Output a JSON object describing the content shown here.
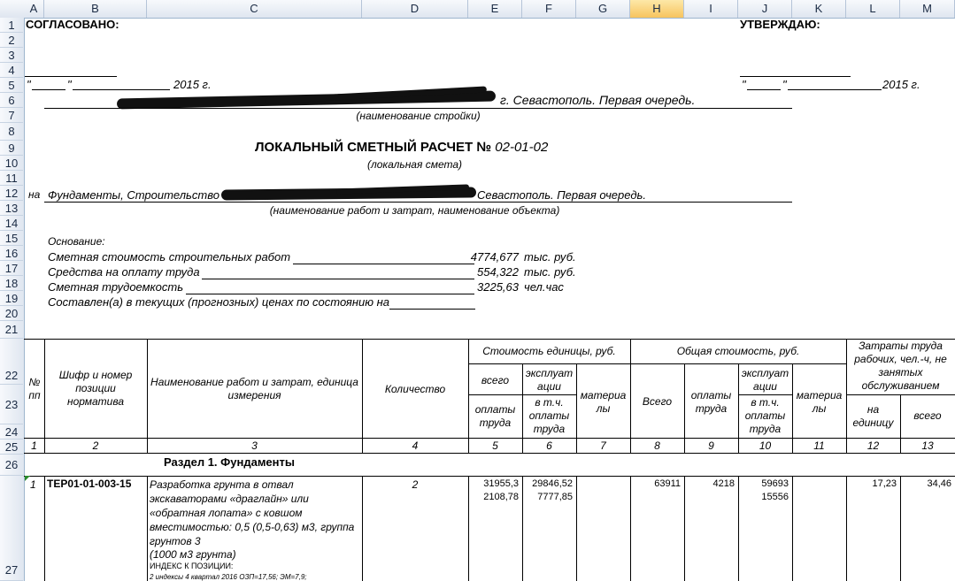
{
  "columns": [
    "A",
    "B",
    "C",
    "D",
    "E",
    "F",
    "G",
    "H",
    "I",
    "J",
    "K",
    "L",
    "M"
  ],
  "rows": [
    "1",
    "2",
    "3",
    "4",
    "5",
    "6",
    "7",
    "8",
    "9",
    "10",
    "11",
    "12",
    "13",
    "14",
    "15",
    "16",
    "17",
    "18",
    "19",
    "20",
    "21",
    "22",
    "23",
    "24",
    "25",
    "26",
    "27"
  ],
  "doc": {
    "agreed": "СОГЛАСОВАНО:",
    "approve": "УТВЕРЖДАЮ:",
    "date_left_q1": "\"",
    "date_left_q2": "\"",
    "date_left_year": "2015 г.",
    "date_right_q1": "\"",
    "date_right_q2": "\"",
    "date_right_year": "2015 г.",
    "construction_name": "г. Севастополь. Первая очередь.",
    "construction_caption": "(наименование стройки)",
    "title_prefix": "ЛОКАЛЬНЫЙ СМЕТНЫЙ РАСЧЕТ №",
    "title_number": "02-01-02",
    "title_caption": "(локальная смета)",
    "on_prefix": "на",
    "work_name_start": "Фундаменты, Строительство",
    "work_name_end": "Севастополь. Первая очередь.",
    "work_caption": "(наименование работ и затрат, наименование объекта)",
    "basis": "Основание:",
    "cost_label": "Сметная стоимость строительных работ",
    "cost_value": "4774,677",
    "cost_unit": "тыс. руб.",
    "wage_label": "Средства на оплату труда",
    "wage_value": "554,322",
    "wage_unit": "тыс. руб.",
    "labor_label": "Сметная трудоемкость",
    "labor_value": "3225,63",
    "labor_unit": "чел.час",
    "prices_label": "Составлен(а) в текущих (прогнозных) ценах по состоянию на"
  },
  "table": {
    "h_no": "№ пп",
    "h_code": "Шифр и номер позиции норматива",
    "h_name": "Наименование работ и затрат, единица измерения",
    "h_qty": "Количество",
    "h_unit_cost": "Стоимость единицы, руб.",
    "h_total_cost": "Общая стоимость, руб.",
    "h_labor": "Затраты труда рабочих, чел.-ч, не занятых обслуживанием",
    "h_all": "всего",
    "h_wage": "оплаты труда",
    "h_exploit": "эксплуатации",
    "h_incl_wage": "в т.ч. оплаты труда",
    "h_materials": "материалы",
    "h_total": "Всего",
    "h_per_unit": "на единицу",
    "h_all2": "всего",
    "colnums": [
      "1",
      "2",
      "3",
      "4",
      "5",
      "6",
      "7",
      "8",
      "9",
      "10",
      "11",
      "12",
      "13"
    ],
    "section": "Раздел 1. Фундаменты",
    "item_no": "1",
    "item_code": "ТЕР01-01-003-15",
    "item_name_1": "Разработка грунта в отвал",
    "item_name_2": "экскаваторами «драглайн» или",
    "item_name_3": "«обратная лопата» с ковшом",
    "item_name_4": "вместимостью: 0,5 (0,5-0,63) м3, группа",
    "item_name_5": "грунтов 3",
    "item_name_6": "(1000 м3 грунта)",
    "item_index": "ИНДЕКС К ПОЗИЦИИ:",
    "item_index2": "2 индексы 4 квартал 2016 ОЗП=17,56; ЭМ=7,9;",
    "item_qty": "2",
    "e1": "31955,3",
    "e2": "2108,78",
    "f1": "29846,52",
    "f2": "7777,85",
    "h1": "63911",
    "i1": "4218",
    "j1": "59693",
    "j2": "15556",
    "l1": "17,23",
    "m1": "34,46"
  }
}
